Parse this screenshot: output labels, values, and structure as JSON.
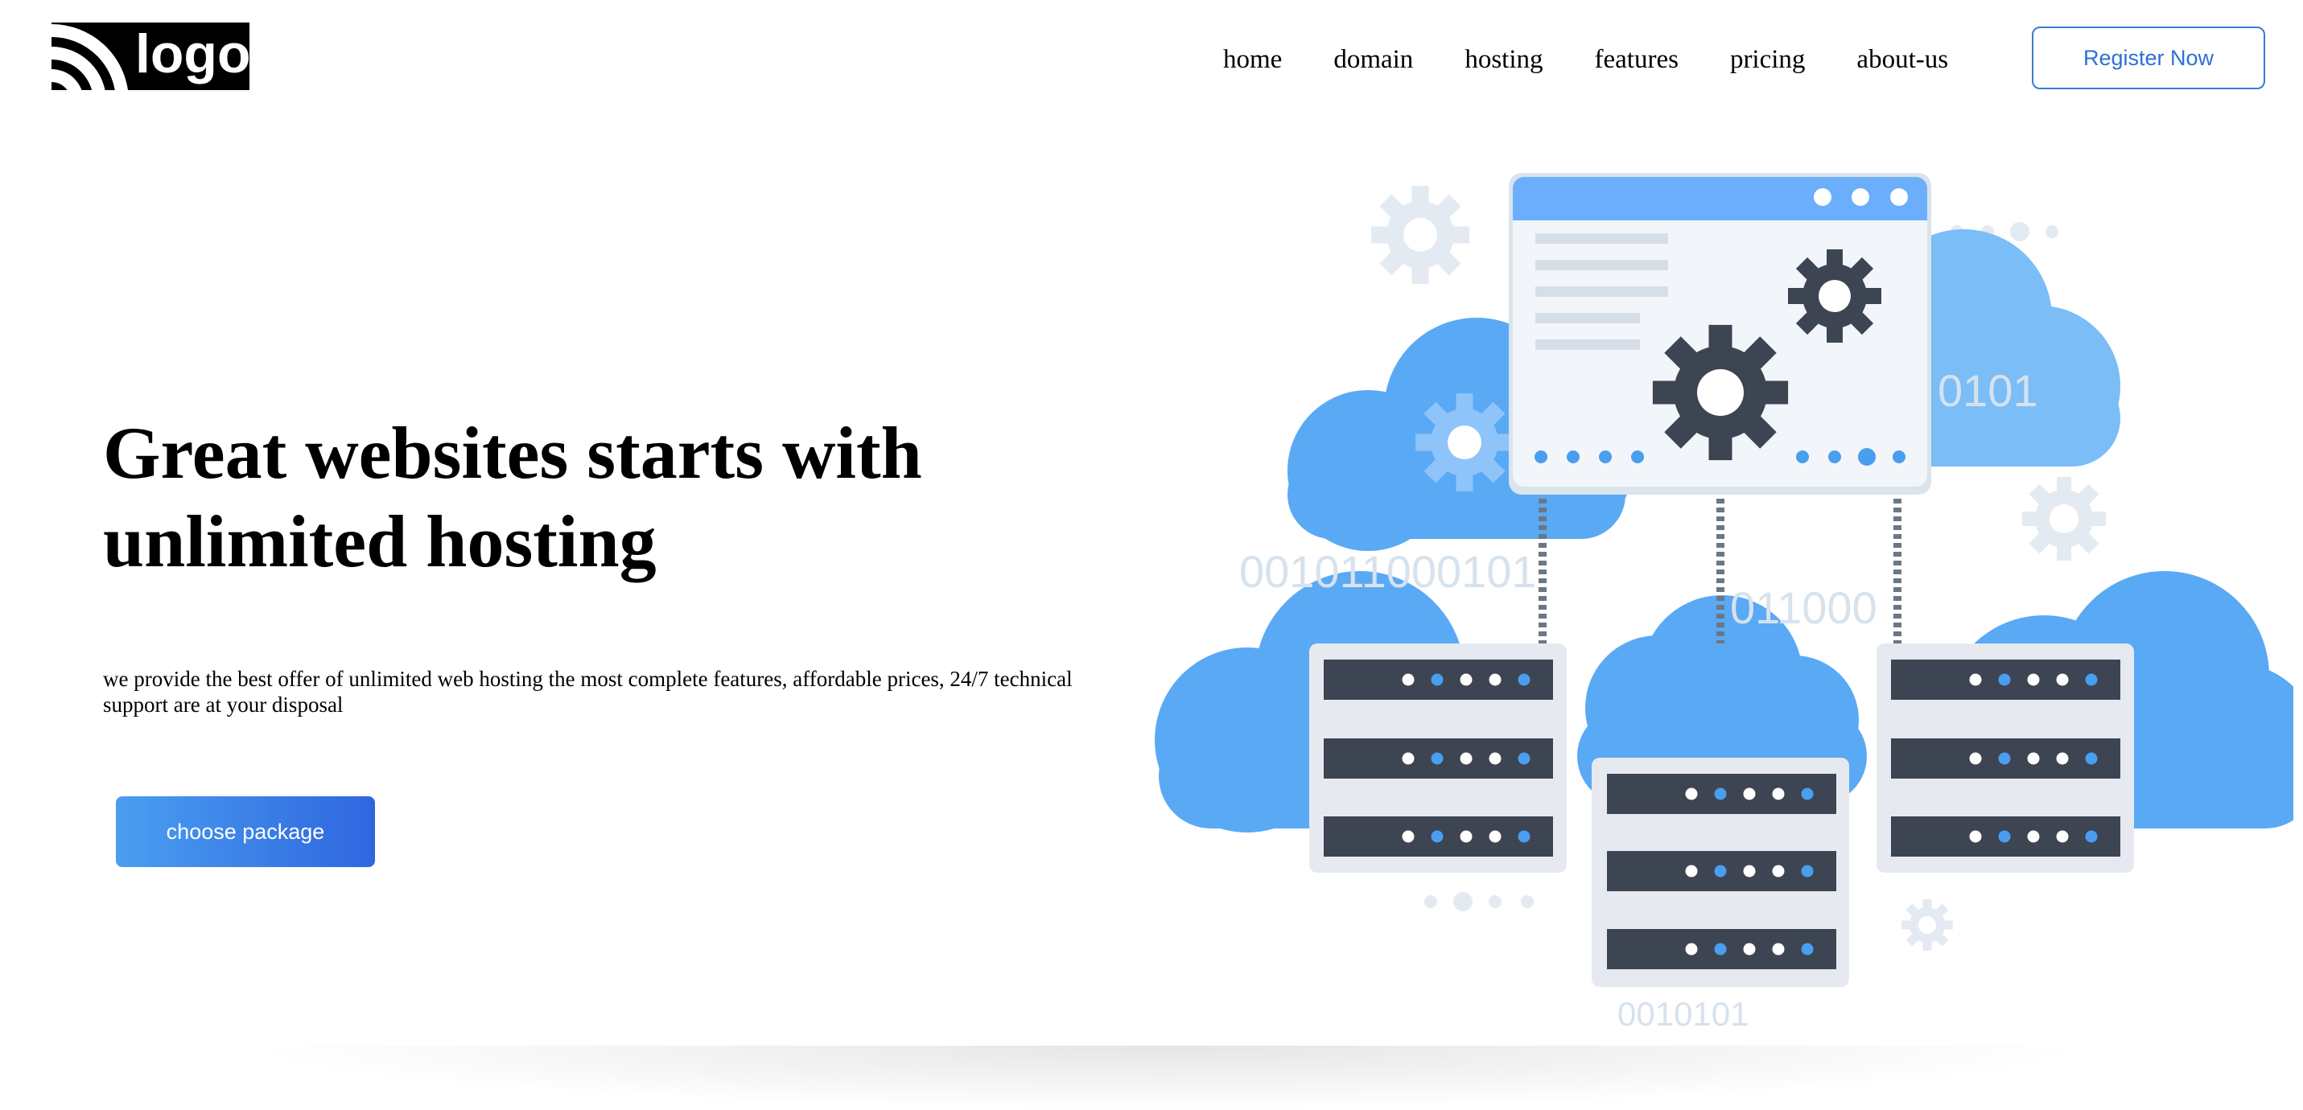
{
  "logo": {
    "text": "logo",
    "icon": "wifi-signal-icon"
  },
  "nav": {
    "items": [
      "home",
      "domain",
      "hosting",
      "features",
      "pricing",
      "about-us"
    ],
    "register_label": "Register Now"
  },
  "hero": {
    "headline_line1": "Great websites starts with",
    "headline_line2": "unlimited hosting",
    "description": "we provide the best offer of unlimited web hosting the most complete features, affordable prices, 24/7 technical support are at your disposal",
    "cta_label": "choose package"
  },
  "illustration": {
    "binary_texts": [
      "0101",
      "001011000101",
      "011000",
      "0010101"
    ],
    "colors": {
      "cloud": "#5aa9f5",
      "cloud_light": "#7bbdf7",
      "window_header": "#6aaefc",
      "server_dark": "#3d4452",
      "server_frame": "#e6eaf0",
      "gear_dark": "#3d4452",
      "gear_light": "#dde6f0",
      "binary": "#d6e2ee"
    }
  },
  "colors": {
    "accent": "#2e6fd8",
    "cta_gradient_start": "#4a9ef0",
    "cta_gradient_end": "#2f66e0"
  }
}
